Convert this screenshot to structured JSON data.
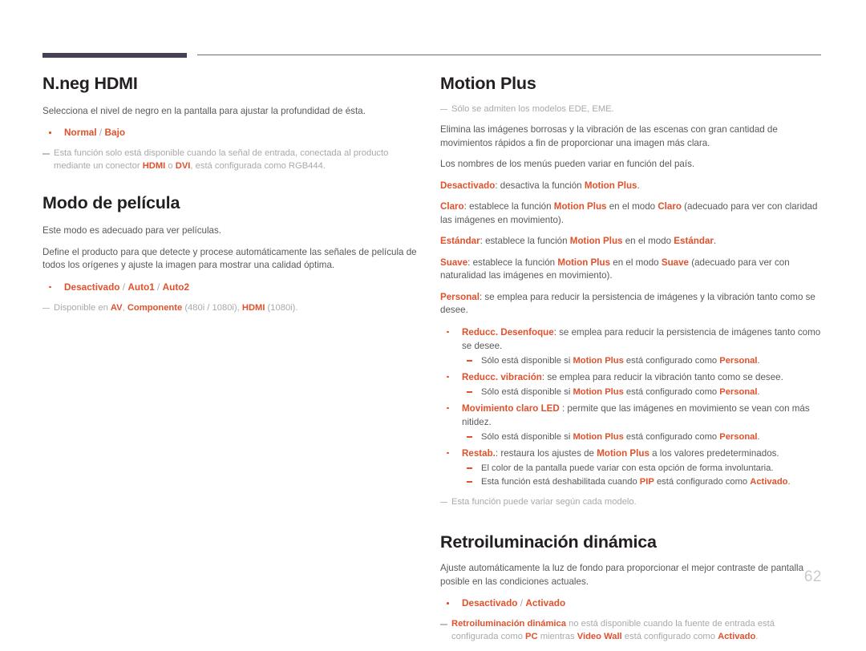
{
  "page": {
    "number": "62",
    "accent_color": "#e0512c",
    "header_bar_color": "#463f56",
    "note_color": "#a7a9ac",
    "body_color": "#58595b",
    "heading_color": "#231f20"
  },
  "left_column": {
    "section1": {
      "title": "N.neg HDMI",
      "intro": "Selecciona el nivel de negro en la pantalla para ajustar la profundidad de ésta.",
      "options": {
        "opt1": "Normal",
        "sep1": " / ",
        "opt2": "Bajo"
      },
      "note": {
        "t1": "Esta función solo está disponible cuando la señal de entrada, conectada al producto mediante un conector ",
        "b1": "HDMI",
        "t2": " o ",
        "b2": "DVI",
        "t3": ", está configurada como RGB444."
      }
    },
    "section2": {
      "title": "Modo de película",
      "para1": "Este modo es adecuado para ver películas.",
      "para2": "Define el producto para que detecte y procese automáticamente las señales de película de todos los orígenes y ajuste la imagen para mostrar una calidad óptima.",
      "options": {
        "opt1": "Desactivado",
        "sep1": " / ",
        "opt2": "Auto1",
        "sep2": " / ",
        "opt3": "Auto2"
      },
      "note": {
        "t1": "Disponible en ",
        "b1": "AV",
        "t2": ", ",
        "b2": "Componente",
        "t3": " (480i / 1080i), ",
        "b3": "HDMI",
        "t4": " (1080i)."
      }
    }
  },
  "right_column": {
    "section1": {
      "title": "Motion Plus",
      "note_top": "Sólo se admiten los modelos EDE, EME.",
      "para1": "Elimina las imágenes borrosas y la vibración de las escenas con gran cantidad de movimientos rápidos a fin de proporcionar una imagen más clara.",
      "para2": "Los nombres de los menús pueden variar en función del país.",
      "modes": {
        "desactivado": {
          "term": "Desactivado",
          "t1": ": desactiva la función ",
          "b1": "Motion Plus",
          "t2": "."
        },
        "claro": {
          "term": "Claro",
          "t1": ": establece la función ",
          "b1": "Motion Plus",
          "t2": " en el modo ",
          "b2": "Claro",
          "t3": " (adecuado para ver con claridad las imágenes en movimiento)."
        },
        "estandar": {
          "term": "Estándar",
          "t1": ": establece la función ",
          "b1": "Motion Plus",
          "t2": " en el modo ",
          "b2": "Estándar",
          "t3": "."
        },
        "suave": {
          "term": "Suave",
          "t1": ": establece la función ",
          "b1": "Motion Plus",
          "t2": " en el modo ",
          "b2": "Suave",
          "t3": " (adecuado para ver con naturalidad las imágenes en movimiento)."
        },
        "personal": {
          "term": "Personal",
          "t1": ": se emplea para reducir la persistencia de imágenes y la vibración tanto como se desee."
        }
      },
      "personal_items": [
        {
          "term": "Reducc. Desenfoque",
          "rest": ": se emplea para reducir la persistencia de imágenes tanto como se desee.",
          "sub": {
            "t1": "Sólo está disponible si ",
            "b1": "Motion Plus",
            "t2": " está configurado como ",
            "b2": "Personal",
            "t3": "."
          }
        },
        {
          "term": "Reducc. vibración",
          "rest": ": se emplea para reducir la vibración tanto como se desee.",
          "sub": {
            "t1": "Sólo está disponible si ",
            "b1": "Motion Plus",
            "t2": " está configurado como ",
            "b2": "Personal",
            "t3": "."
          }
        },
        {
          "term": "Movimiento claro LED",
          "rest": " : permite que las imágenes en movimiento se vean con más nitidez.",
          "sub": {
            "t1": "Sólo está disponible si ",
            "b1": "Motion Plus",
            "t2": " está configurado como ",
            "b2": "Personal",
            "t3": "."
          }
        }
      ],
      "restab": {
        "term": "Restab.",
        "t1": ": restaura los ajustes de ",
        "b1": "Motion Plus",
        "t2": " a los valores predeterminados.",
        "sub1": "El color de la pantalla puede variar con esta opción de forma involuntaria.",
        "sub2": {
          "t1": "Esta función está deshabilitada cuando ",
          "b1": "PIP",
          "t2": " está configurado como ",
          "b2": "Activado",
          "t3": "."
        }
      },
      "note_bottom": "Esta función puede variar según cada modelo."
    },
    "section2": {
      "title": "Retroiluminación dinámica",
      "para1": "Ajuste automáticamente la luz de fondo para proporcionar el mejor contraste de pantalla posible en las condiciones actuales.",
      "options": {
        "opt1": "Desactivado",
        "sep1": " / ",
        "opt2": "Activado"
      },
      "note": {
        "b1": "Retroiluminación dinámica",
        "t1": " no está disponible cuando la fuente de entrada está configurada como ",
        "b2": "PC",
        "t2": " mientras ",
        "b3": "Video Wall",
        "t3": " está configurado como ",
        "b4": "Activado",
        "t4": "."
      }
    }
  }
}
